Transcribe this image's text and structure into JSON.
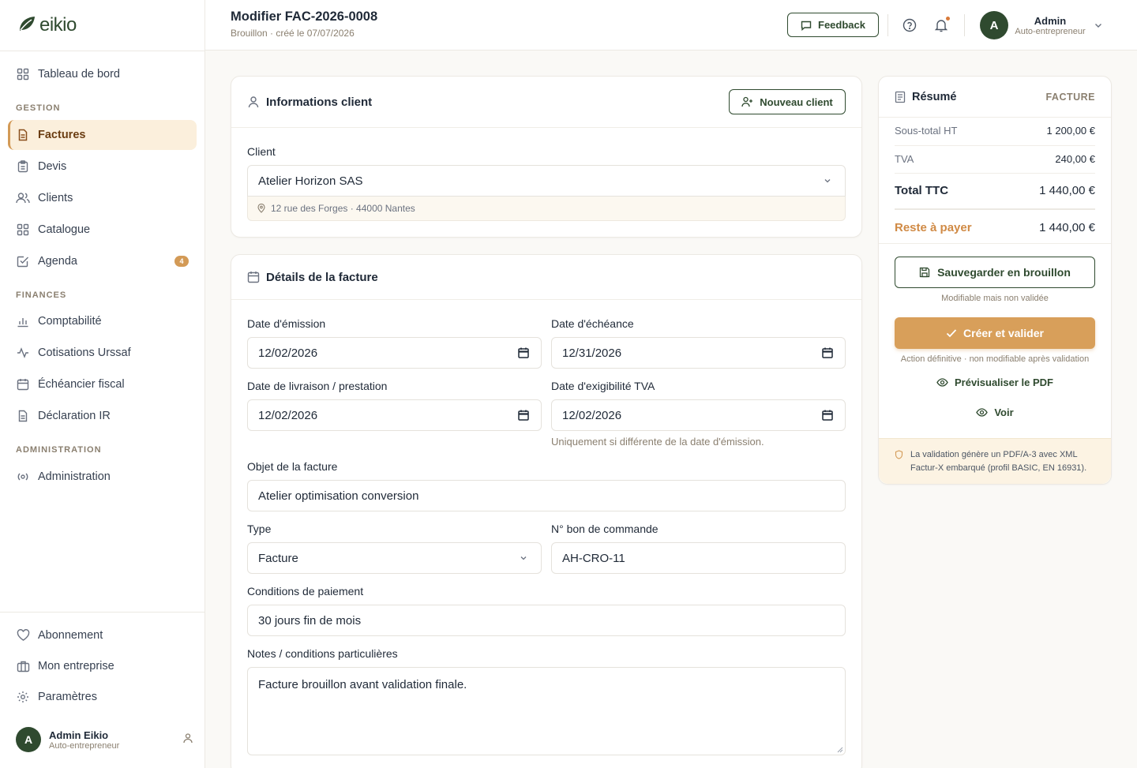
{
  "brand": {
    "name": "eikio",
    "color": "#2f4a2f",
    "accent": "#d39a56"
  },
  "sidebar": {
    "dashboard": "Tableau de bord",
    "sections": {
      "gestion": "GESTION",
      "finances": "FINANCES",
      "administration": "ADMINISTRATION"
    },
    "items": {
      "factures": "Factures",
      "devis": "Devis",
      "clients": "Clients",
      "catalogue": "Catalogue",
      "agenda": "Agenda",
      "agenda_badge": "4",
      "comptabilite": "Comptabilité",
      "cotisations": "Cotisations Urssaf",
      "echeancier": "Échéancier fiscal",
      "declaration": "Déclaration IR",
      "administration": "Administration"
    },
    "bottom": {
      "abonnement": "Abonnement",
      "entreprise": "Mon entreprise",
      "parametres": "Paramètres"
    },
    "user": {
      "initial": "A",
      "name": "Admin Eikio",
      "role": "Auto-entrepreneur"
    }
  },
  "header": {
    "title": "Modifier FAC-2026-0008",
    "subtitle": "Brouillon · créé le 07/07/2026",
    "feedback": "Feedback",
    "user": {
      "initial": "A",
      "name": "Admin",
      "role": "Auto-entrepreneur"
    }
  },
  "client_card": {
    "title": "Informations client",
    "new_client": "Nouveau client",
    "client_label": "Client",
    "client_value": "Atelier Horizon SAS",
    "address": "12 rue des Forges · 44000 Nantes"
  },
  "details_card": {
    "title": "Détails de la facture",
    "emission_label": "Date d'émission",
    "emission_value": "12/02/2026",
    "echeance_label": "Date d'échéance",
    "echeance_value": "12/31/2026",
    "livraison_label": "Date de livraison / prestation",
    "livraison_value": "12/02/2026",
    "tva_label": "Date d'exigibilité TVA",
    "tva_value": "12/02/2026",
    "tva_hint": "Uniquement si différente de la date d'émission.",
    "objet_label": "Objet de la facture",
    "objet_value": "Atelier optimisation conversion",
    "type_label": "Type",
    "type_value": "Facture",
    "bon_label": "N° bon de commande",
    "bon_value": "AH-CRO-11",
    "conditions_label": "Conditions de paiement",
    "conditions_value": "30 jours fin de mois",
    "notes_label": "Notes / conditions particulières",
    "notes_value": "Facture brouillon avant validation finale."
  },
  "summary": {
    "title": "Résumé",
    "tag": "FACTURE",
    "subtotal_label": "Sous-total HT",
    "subtotal_value": "1 200,00 €",
    "tva_label": "TVA",
    "tva_value": "240,00 €",
    "total_label": "Total TTC",
    "total_value": "1 440,00 €",
    "reste_label": "Reste à payer",
    "reste_value": "1 440,00 €",
    "save_draft": "Sauvegarder en brouillon",
    "save_hint": "Modifiable mais non validée",
    "create": "Créer et valider",
    "create_hint": "Action définitive · non modifiable après validation",
    "preview": "Prévisualiser le PDF",
    "voir": "Voir",
    "notice": "La validation génère un PDF/A-3 avec XML Factur-X embarqué (profil BASIC, EN 16931)."
  }
}
